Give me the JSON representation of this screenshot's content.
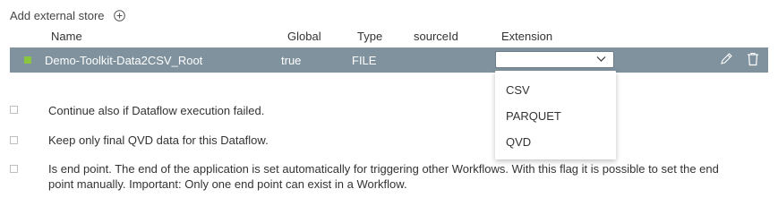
{
  "add_store": {
    "label": "Add external store",
    "icon": "plus-circle-icon"
  },
  "table": {
    "columns": [
      "Name",
      "Global",
      "Type",
      "sourceId",
      "Extension"
    ],
    "row": {
      "name": "Demo-Toolkit-Data2CSV_Root",
      "global": "true",
      "type": "FILE",
      "source_id": "",
      "extension": "",
      "status_color": "#8ac53f",
      "row_color": "#7f929d"
    }
  },
  "extension_options": [
    "CSV",
    "PARQUET",
    "QVD"
  ],
  "options": [
    {
      "label": "Continue also if Dataflow execution failed.",
      "checked": false
    },
    {
      "label": "Keep only final QVD data for this Dataflow.",
      "checked": false
    },
    {
      "label": "Is end point. The end of the application is set automatically for triggering other Workflows. With this flag it is possible to set the end point manually. Important: Only one end point can exist in a Workflow.",
      "checked": false
    }
  ]
}
